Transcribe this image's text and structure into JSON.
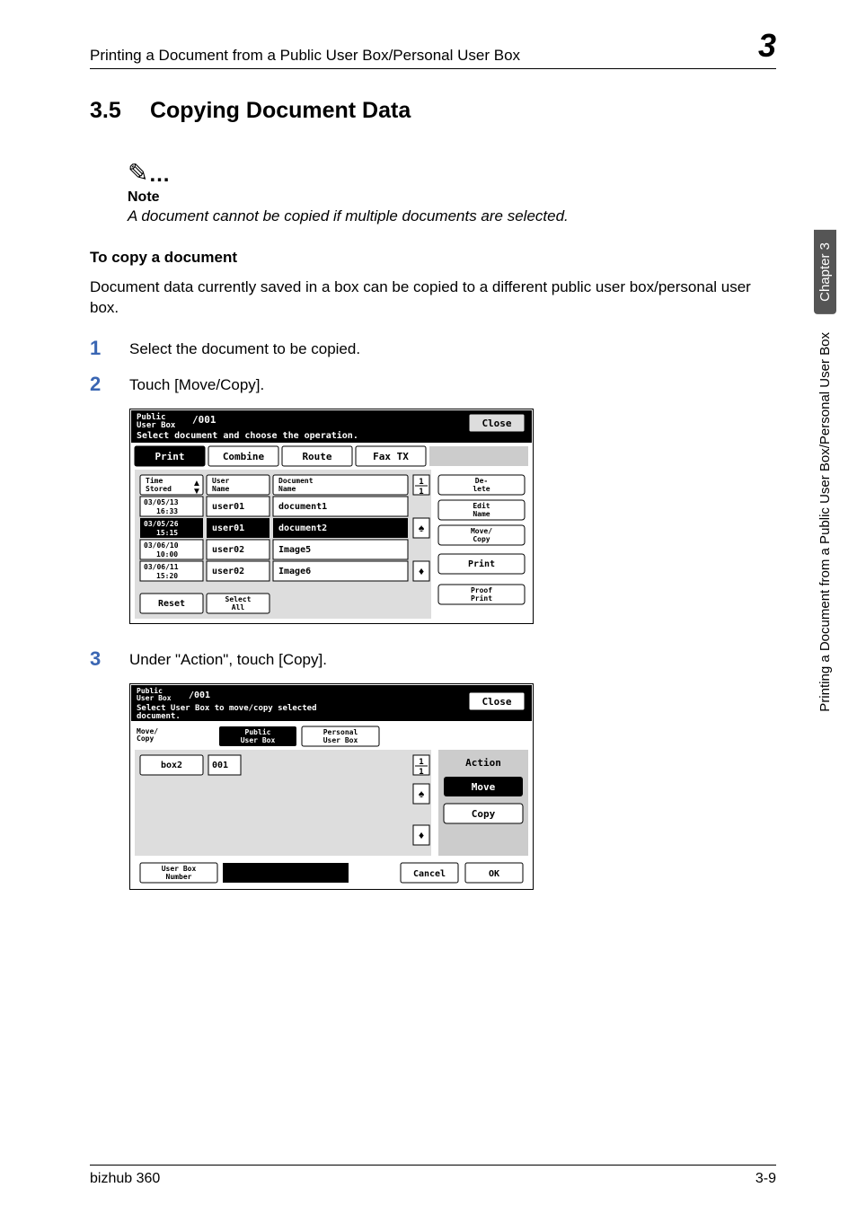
{
  "header": {
    "title": "Printing a Document from a Public User Box/Personal User Box",
    "chapter_num": "3"
  },
  "section": {
    "number": "3.5",
    "title": "Copying Document Data"
  },
  "note": {
    "label": "Note",
    "body": "A document cannot be copied if multiple documents are selected."
  },
  "sub_heading": "To copy a document",
  "intro": "Document data currently saved in a box can be copied to a different public user box/personal user box.",
  "steps": {
    "s1_num": "1",
    "s1_text": "Select the document to be copied.",
    "s2_num": "2",
    "s2_text": "Touch [Move/Copy].",
    "s3_num": "3",
    "s3_text": "Under \"Action\", touch [Copy]."
  },
  "figure1": {
    "box_label": "Public\nUser Box",
    "box_num": "/001",
    "prompt": "Select document and choose the operation.",
    "close": "Close",
    "tabs": [
      "Print",
      "Combine",
      "Route",
      "Fax TX"
    ],
    "cols": [
      "Time\nStored",
      "User\nName",
      "Document\nName"
    ],
    "page": "1/1",
    "rows": [
      {
        "time": "03/05/13\n16:33",
        "user": "user01",
        "doc": "document1"
      },
      {
        "time": "03/05/26\n15:15",
        "user": "user01",
        "doc": "document2"
      },
      {
        "time": "03/06/10\n10:00",
        "user": "user02",
        "doc": "Image5"
      },
      {
        "time": "03/06/11\n15:20",
        "user": "user02",
        "doc": "Image6"
      }
    ],
    "reset": "Reset",
    "select_all": "Select\nAll",
    "side": [
      "De-\nlete",
      "Edit\nName",
      "Move/\nCopy",
      "Print",
      "Proof\nPrint"
    ]
  },
  "figure2": {
    "box_label": "Public\nUser Box",
    "box_num": "/001",
    "prompt": "Select User Box to move/copy selected\ndocument.",
    "close": "Close",
    "mode": "Move/\nCopy",
    "tabs": [
      "Public\nUser Box",
      "Personal\nUser Box"
    ],
    "list": [
      {
        "name": "box2",
        "num": "001"
      }
    ],
    "page": "1/1",
    "action_label": "Action",
    "move": "Move",
    "copy": "Copy",
    "userbox_num": "User Box\nNumber",
    "cancel": "Cancel",
    "ok": "OK"
  },
  "side_tab": {
    "dark": "Chapter 3",
    "light": "Printing a Document from a Public User Box/Personal User Box"
  },
  "footer": {
    "left": "bizhub 360",
    "right": "3-9"
  }
}
